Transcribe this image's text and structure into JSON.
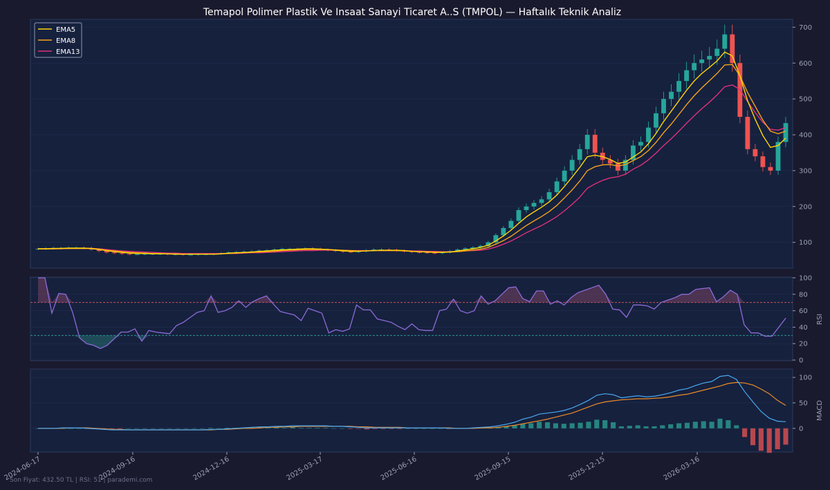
{
  "title": "Temapol Polimer Plastik Ve Insaat Sanayi Ticaret A..S (TMPOL) — Haftalık Teknik Analiz",
  "footer": "Son Fiyat: 432.50 TL  |  RSI: 51  |  parademi.com",
  "colors": {
    "background": "#1a1a2e",
    "panel": "#16213e",
    "up": "#26a69a",
    "down": "#ef5350",
    "ema5": "#ffd60a",
    "ema8": "#f7a21b",
    "ema13": "#e0307a",
    "rsi": "#8e6bd8",
    "macd": "#4aa8f0",
    "signal": "#f08c2a"
  },
  "chart_data": {
    "type": "candlestick",
    "x_ticks": [
      "2024-06-17",
      "2024-09-16",
      "2024-12-16",
      "2025-03-17",
      "2025-06-16",
      "2025-09-15",
      "2025-12-15",
      "2026-03-16"
    ],
    "legend": [
      "EMA5",
      "EMA8",
      "EMA13"
    ],
    "legend_position": "top-left",
    "price": {
      "ylim": [
        30,
        720
      ],
      "yticks": [
        100,
        200,
        300,
        400,
        500,
        600,
        700
      ],
      "close": [
        82,
        83,
        84,
        84,
        85,
        85,
        84,
        80,
        76,
        72,
        70,
        68,
        67,
        67,
        68,
        68,
        68,
        67,
        67,
        66,
        66,
        67,
        67,
        68,
        70,
        72,
        73,
        74,
        75,
        77,
        78,
        80,
        82,
        82,
        82,
        83,
        82,
        80,
        78,
        76,
        74,
        73,
        75,
        78,
        80,
        80,
        79,
        77,
        75,
        73,
        72,
        71,
        70,
        72,
        76,
        80,
        83,
        86,
        90,
        100,
        120,
        140,
        160,
        190,
        200,
        210,
        220,
        240,
        270,
        300,
        330,
        360,
        400,
        350,
        330,
        320,
        300,
        330,
        370,
        380,
        420,
        460,
        500,
        520,
        550,
        580,
        600,
        610,
        620,
        640,
        680,
        600,
        450,
        360,
        340,
        310,
        300,
        380,
        432.5
      ],
      "ema5": [
        82,
        82,
        83,
        83,
        84,
        84,
        84,
        83,
        80,
        77,
        74,
        72,
        70,
        69,
        69,
        68,
        68,
        68,
        67,
        67,
        67,
        67,
        67,
        67,
        68,
        70,
        71,
        72,
        73,
        75,
        76,
        78,
        79,
        80,
        81,
        82,
        82,
        81,
        80,
        78,
        76,
        75,
        75,
        76,
        77,
        78,
        78,
        78,
        77,
        75,
        74,
        73,
        72,
        72,
        73,
        76,
        79,
        82,
        86,
        92,
        104,
        118,
        134,
        153,
        171,
        185,
        198,
        213,
        232,
        256,
        282,
        309,
        339,
        343,
        339,
        331,
        320,
        324,
        338,
        352,
        375,
        404,
        437,
        466,
        495,
        524,
        550,
        571,
        588,
        606,
        631,
        620,
        564,
        495,
        443,
        398,
        365,
        370,
        391
      ],
      "ema8": [
        82,
        82,
        82,
        83,
        83,
        83,
        83,
        83,
        81,
        78,
        76,
        74,
        72,
        71,
        70,
        69,
        69,
        68,
        68,
        67,
        67,
        67,
        67,
        67,
        68,
        69,
        70,
        71,
        72,
        73,
        74,
        75,
        77,
        78,
        79,
        80,
        80,
        80,
        80,
        79,
        78,
        77,
        76,
        76,
        77,
        77,
        77,
        77,
        76,
        75,
        74,
        74,
        73,
        73,
        73,
        74,
        76,
        78,
        81,
        86,
        95,
        105,
        117,
        132,
        147,
        160,
        172,
        186,
        203,
        224,
        246,
        271,
        300,
        311,
        316,
        317,
        313,
        317,
        328,
        339,
        356,
        379,
        406,
        430,
        457,
        484,
        509,
        531,
        551,
        571,
        595,
        596,
        564,
        518,
        479,
        441,
        410,
        403,
        410
      ],
      "ema13": [
        82,
        82,
        82,
        82,
        83,
        83,
        83,
        83,
        82,
        80,
        78,
        76,
        75,
        74,
        73,
        72,
        71,
        70,
        70,
        69,
        69,
        69,
        69,
        69,
        69,
        69,
        69,
        70,
        71,
        71,
        72,
        73,
        74,
        75,
        76,
        77,
        77,
        78,
        78,
        78,
        77,
        77,
        77,
        77,
        77,
        77,
        77,
        77,
        77,
        76,
        76,
        75,
        75,
        74,
        74,
        75,
        76,
        77,
        78,
        81,
        87,
        95,
        104,
        115,
        127,
        137,
        147,
        159,
        172,
        188,
        206,
        226,
        251,
        263,
        273,
        280,
        283,
        290,
        304,
        315,
        330,
        349,
        370,
        389,
        410,
        432,
        453,
        473,
        491,
        511,
        534,
        539,
        526,
        493,
        462,
        435,
        415,
        413,
        420
      ]
    },
    "rsi": {
      "ylabel": "RSI",
      "ylim": [
        0,
        100
      ],
      "yticks": [
        0,
        20,
        40,
        60,
        80,
        100
      ],
      "levels": [
        70,
        30
      ],
      "values": [
        100,
        100,
        57,
        81,
        80,
        58,
        27,
        20,
        18,
        14,
        18,
        26,
        34,
        34,
        38,
        23,
        36,
        34,
        33,
        32,
        42,
        46,
        52,
        58,
        60,
        78,
        58,
        60,
        64,
        72,
        64,
        71,
        75,
        78,
        68,
        59,
        57,
        55,
        48,
        63,
        60,
        57,
        33,
        37,
        35,
        38,
        67,
        61,
        61,
        50,
        48,
        46,
        41,
        37,
        44,
        37,
        36,
        36,
        60,
        62,
        74,
        60,
        57,
        60,
        78,
        68,
        72,
        80,
        88,
        89,
        75,
        71,
        84,
        84,
        68,
        72,
        67,
        76,
        82,
        85,
        88,
        91,
        80,
        62,
        61,
        52,
        67,
        67,
        66,
        62,
        70,
        73,
        76,
        80,
        80,
        86,
        87,
        88,
        71,
        77,
        85,
        80,
        43,
        33,
        33,
        29,
        29,
        40,
        51
      ],
      "offsets_note": ""
    },
    "macd": {
      "ylabel": "MACD",
      "ylim": [
        -45,
        115
      ],
      "yticks": [
        0,
        50,
        100
      ],
      "macd": [
        0,
        0,
        0,
        1,
        1,
        1,
        0,
        -1,
        -2,
        -3,
        -3,
        -3,
        -3,
        -3,
        -3,
        -3,
        -3,
        -3,
        -3,
        -3,
        -3,
        -2,
        -2,
        -1,
        0,
        1,
        2,
        3,
        3,
        4,
        4,
        5,
        5,
        5,
        5,
        5,
        4,
        4,
        3,
        2,
        1,
        1,
        1,
        1,
        1,
        1,
        1,
        1,
        1,
        1,
        0,
        0,
        0,
        1,
        2,
        3,
        5,
        8,
        12,
        18,
        22,
        28,
        30,
        32,
        35,
        40,
        47,
        55,
        65,
        68,
        66,
        60,
        62,
        64,
        62,
        63,
        66,
        70,
        75,
        78,
        84,
        89,
        92,
        102,
        104,
        96,
        72,
        52,
        33,
        20,
        14,
        13
      ],
      "signal": [
        0,
        0,
        0,
        0,
        1,
        1,
        1,
        0,
        -1,
        -2,
        -2,
        -3,
        -3,
        -3,
        -3,
        -3,
        -3,
        -3,
        -3,
        -3,
        -3,
        -3,
        -2,
        -2,
        -1,
        0,
        0,
        1,
        2,
        2,
        3,
        3,
        4,
        4,
        4,
        4,
        4,
        4,
        4,
        3,
        3,
        2,
        2,
        2,
        2,
        1,
        1,
        1,
        1,
        1,
        1,
        0,
        0,
        0,
        1,
        1,
        2,
        4,
        6,
        9,
        12,
        15,
        18,
        22,
        26,
        30,
        36,
        42,
        48,
        52,
        54,
        56,
        57,
        58,
        58,
        59,
        60,
        62,
        65,
        67,
        71,
        75,
        79,
        83,
        88,
        90,
        89,
        85,
        77,
        68,
        55,
        45
      ]
    },
    "xlabel": "",
    "ylabel": ""
  }
}
